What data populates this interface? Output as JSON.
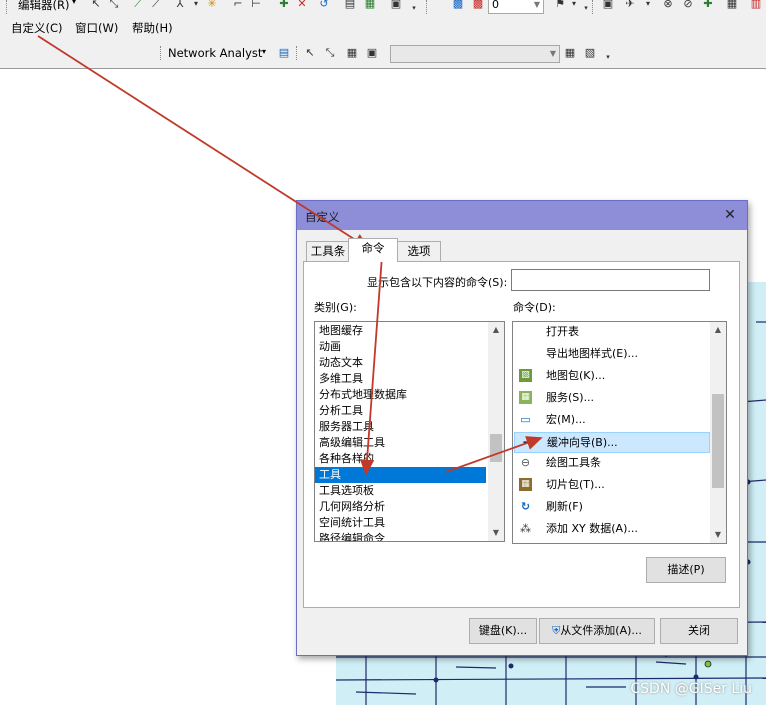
{
  "toolbar": {
    "editor_label": "编辑器(R)",
    "network_analyst_label": "Network Analyst",
    "layer_combo_value": "0",
    "menus": [
      "自定义(C)",
      "窗口(W)",
      "帮助(H)"
    ]
  },
  "dialog": {
    "title": "自定义",
    "tabs": [
      "工具条",
      "命令",
      "选项"
    ],
    "active_tab": "命令",
    "filter_label": "显示包含以下内容的命令(S):",
    "filter_value": "",
    "categories_label": "类别(G):",
    "commands_label": "命令(D):",
    "categories": [
      "地图缓存",
      "动画",
      "动态文本",
      "多维工具",
      "分布式地理数据库",
      "分析工具",
      "服务器工具",
      "高级编辑工具",
      "各种各样的",
      "工具",
      "工具选项板",
      "几何网络分析",
      "空间统计工具",
      "路径编辑命令"
    ],
    "selected_category": "工具",
    "commands": [
      {
        "label": "打开表",
        "icon": "none"
      },
      {
        "label": "导出地图样式(E)...",
        "icon": "none"
      },
      {
        "label": "地图包(K)...",
        "icon": "map-package-icon"
      },
      {
        "label": "服务(S)...",
        "icon": "service-icon"
      },
      {
        "label": "宏(M)...",
        "icon": "macro-icon"
      },
      {
        "label": "缓冲向导(B)...",
        "icon": "buffer-icon"
      },
      {
        "label": "绘图工具条",
        "icon": "draw-toolbar-icon"
      },
      {
        "label": "切片包(T)...",
        "icon": "tile-package-icon"
      },
      {
        "label": "刷新(F)",
        "icon": "refresh-icon"
      },
      {
        "label": "添加 XY 数据(A)...",
        "icon": "add-xy-icon"
      }
    ],
    "selected_command": "缓冲向导(B)...",
    "describe_button": "描述(P)",
    "keyboard_button": "键盘(K)...",
    "add_from_file_button": "从文件添加(A)...",
    "close_button": "关闭"
  },
  "watermark": "CSDN @GISer Liu",
  "colors": {
    "title_bar": "#8d8dd8",
    "selection": "#0078d7",
    "command_selection": "#cce8ff",
    "annotation_arrow": "#c0392b",
    "map_background": "#cfeef6"
  }
}
